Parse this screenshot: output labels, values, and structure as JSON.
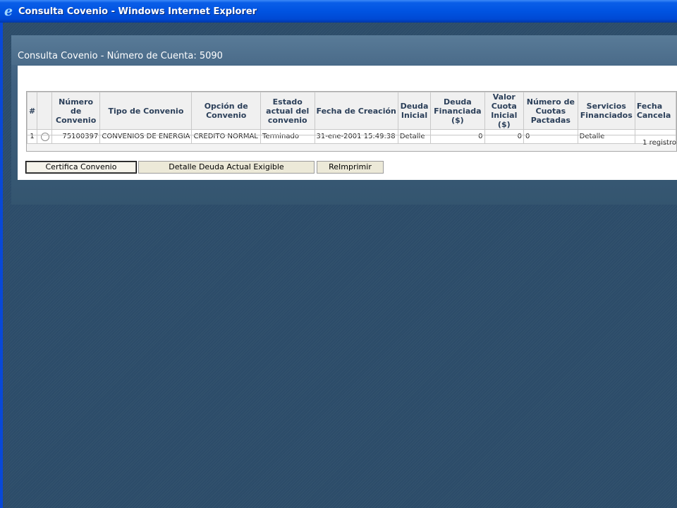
{
  "window": {
    "title": "Consulta Covenio - Windows Internet Explorer"
  },
  "page": {
    "title": "Consulta Covenio - Número de Cuenta: 5090"
  },
  "table": {
    "headers": [
      "#",
      "",
      "Número de Convenio",
      "Tipo de Convenio",
      "Opción de Convenio",
      "Estado actual del convenio",
      "Fecha de Creación",
      "Deuda Inicial",
      "Deuda Financiada ($)",
      "Valor Cuota Inicial ($)",
      "Número de Cuotas Pactadas",
      "Servicios Financiados",
      "Fecha Cancela"
    ],
    "rows": [
      {
        "row_number": "1",
        "numero_convenio": "75100397",
        "tipo_convenio": "CONVENIOS DE ENERGIA",
        "opcion_convenio": "CREDITO NORMAL",
        "estado": "Terminado",
        "fecha_creacion": "31-ene-2001 15:49:38",
        "deuda_inicial": "Detalle",
        "deuda_financiada": "0",
        "valor_cuota_inicial": "0",
        "numero_cuotas": "0",
        "servicios_financiados": "Detalle",
        "fecha_cancelacion": ""
      }
    ],
    "record_count": "1 registro"
  },
  "buttons": {
    "certifica": "Certifica Convenio",
    "detalle_deuda": "Detalle Deuda Actual Exigible",
    "reimprimir": "ReImprimir"
  }
}
